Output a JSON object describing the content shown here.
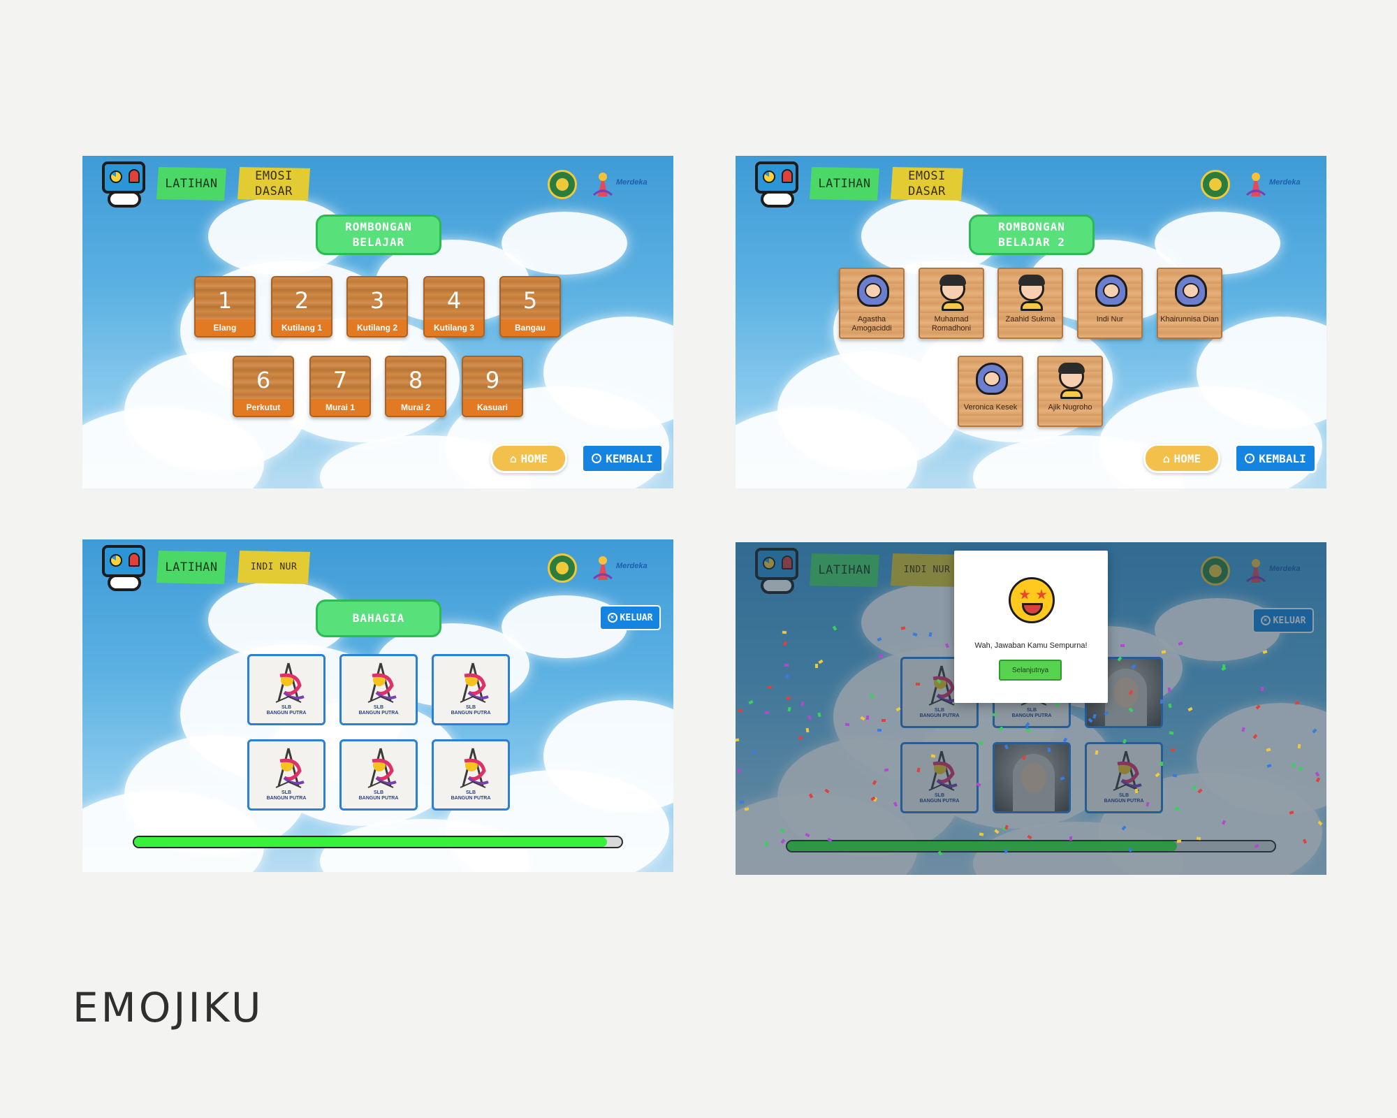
{
  "caption": "EMOJIKU",
  "common": {
    "tag_latihan": "LATIHAN",
    "partner_text": "Merdeka",
    "home_label": "HOME",
    "back_label": "KEMBALI",
    "exit_label": "KELUAR"
  },
  "screen1": {
    "tag_category": "EMOSI DASAR",
    "title": "ROMBONGAN BELAJAR",
    "groups": [
      {
        "number": "1",
        "label": "Elang"
      },
      {
        "number": "2",
        "label": "Kutilang 1"
      },
      {
        "number": "3",
        "label": "Kutilang 2"
      },
      {
        "number": "4",
        "label": "Kutilang 3"
      },
      {
        "number": "5",
        "label": "Bangau"
      },
      {
        "number": "6",
        "label": "Perkutut"
      },
      {
        "number": "7",
        "label": "Murai 1"
      },
      {
        "number": "8",
        "label": "Murai 2"
      },
      {
        "number": "9",
        "label": "Kasuari"
      }
    ]
  },
  "screen2": {
    "tag_category": "EMOSI DASAR",
    "title": "ROMBONGAN BELAJAR 2",
    "students": [
      {
        "name": "Agastha Amogaciddi",
        "avatar": "hijab"
      },
      {
        "name": "Muhamad Romadhoni",
        "avatar": "boy"
      },
      {
        "name": "Zaahid Sukma",
        "avatar": "boy"
      },
      {
        "name": "Indi Nur",
        "avatar": "hijab"
      },
      {
        "name": "Khairunnisa Dian",
        "avatar": "hijab"
      },
      {
        "name": "Veronica Kesek",
        "avatar": "hijab"
      },
      {
        "name": "Ajik Nugroho",
        "avatar": "boy"
      }
    ]
  },
  "screen3": {
    "tag_student": "INDI NUR",
    "emotion_title": "BAHAGIA",
    "card_brand_line1": "SLB",
    "card_brand_line2": "BANGUN PUTRA",
    "progress": 0.97
  },
  "screen4": {
    "tag_student": "INDI NUR",
    "modal_message": "Wah, Jawaban Kamu Sempurna!",
    "modal_button": "Selanjutnya",
    "card_brand_line1": "SLB",
    "card_brand_line2": "BANGUN PUTRA",
    "progress": 0.8
  },
  "colors": {
    "accent_green": "#58e07a",
    "accent_yellow": "#e2cb33",
    "accent_blue": "#1584e0",
    "wood_orange": "#e17a22",
    "progress_green": "#39f13b"
  }
}
